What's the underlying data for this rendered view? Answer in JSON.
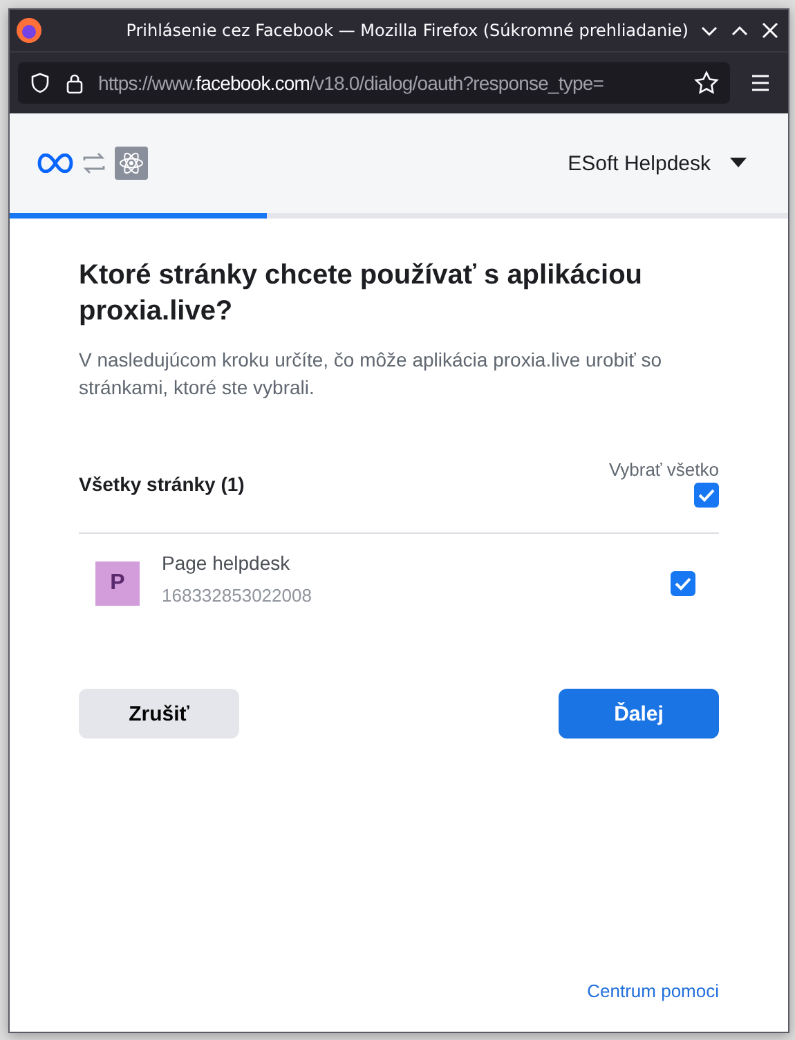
{
  "window": {
    "title": "Prihlásenie cez Facebook — Mozilla Firefox (Súkromné prehliadanie)"
  },
  "address_bar": {
    "prefix": "https://www.",
    "host": "facebook.com",
    "path": "/v18.0/dialog/oauth?response_type="
  },
  "header": {
    "account": "ESoft Helpdesk"
  },
  "progress": {
    "level": 0.33
  },
  "dialog": {
    "title": "Ktoré stránky chcete používať s aplikáciou proxia.live?",
    "description": "V nasledujúcom kroku určíte, čo môže aplikácia proxia.live urobiť so stránkami, ktoré ste vybrali.",
    "list_title": "Všetky stránky (1)",
    "select_all": {
      "label": "Vybrať všetko",
      "checked": true
    },
    "pages": [
      {
        "initial": "P",
        "name": "Page helpdesk",
        "id": "168332853022008",
        "checked": true,
        "color": "#d39ddb"
      }
    ],
    "buttons": [
      {
        "kind": "secondary",
        "label": "Zrušiť"
      },
      {
        "kind": "primary",
        "label": "Ďalej"
      }
    ],
    "help_link": "Centrum pomoci"
  }
}
